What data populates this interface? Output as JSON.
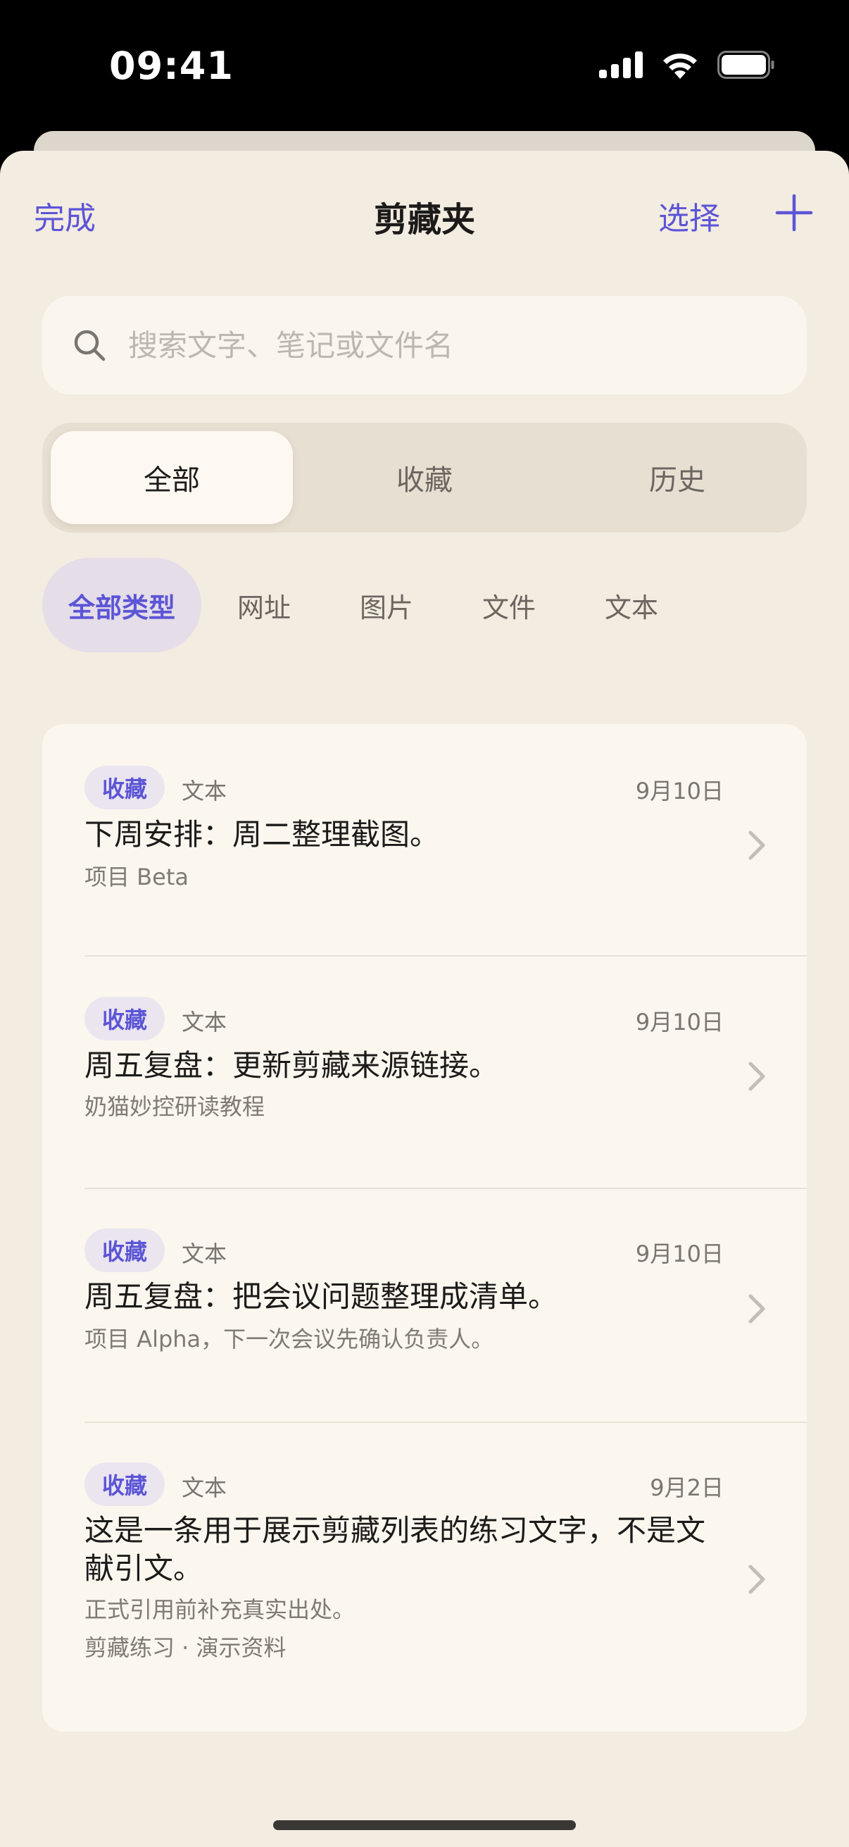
{
  "status_bar": {
    "time": "09:41"
  },
  "nav": {
    "done_label": "完成",
    "title": "剪藏夹",
    "select_label": "选择",
    "add_icon": "plus-icon"
  },
  "search": {
    "placeholder": "搜索文字、笔记或文件名",
    "value": "",
    "icon": "search-icon"
  },
  "segments": {
    "all": "全部",
    "favorites": "收藏",
    "history": "历史",
    "selected": "全部"
  },
  "type_filters": {
    "all_types": "全部类型",
    "url": "网址",
    "image": "图片",
    "file": "文件",
    "text": "文本",
    "selected": "全部类型"
  },
  "items": [
    {
      "badge": "收藏",
      "type": "文本",
      "date": "9月10日",
      "title": "下周安排：周二整理截图。",
      "subtitle": "项目 Beta",
      "meta": ""
    },
    {
      "badge": "收藏",
      "type": "文本",
      "date": "9月10日",
      "title": "周五复盘：更新剪藏来源链接。",
      "subtitle": "奶猫妙控研读教程",
      "meta": ""
    },
    {
      "badge": "收藏",
      "type": "文本",
      "date": "9月10日",
      "title": "周五复盘：把会议问题整理成清单。",
      "subtitle": "项目 Alpha，下一次会议先确认负责人。",
      "meta": ""
    },
    {
      "badge": "收藏",
      "type": "文本",
      "date": "9月2日",
      "title": "这是一条用于展示剪藏列表的练习文字，不是文献引文。",
      "subtitle": "正式引用前补充真实出处。",
      "meta": "剪藏练习 · 演示资料"
    }
  ],
  "colors": {
    "accent": "#5c55d6",
    "background": "#f3ece1",
    "card": "#fbf7ef"
  }
}
